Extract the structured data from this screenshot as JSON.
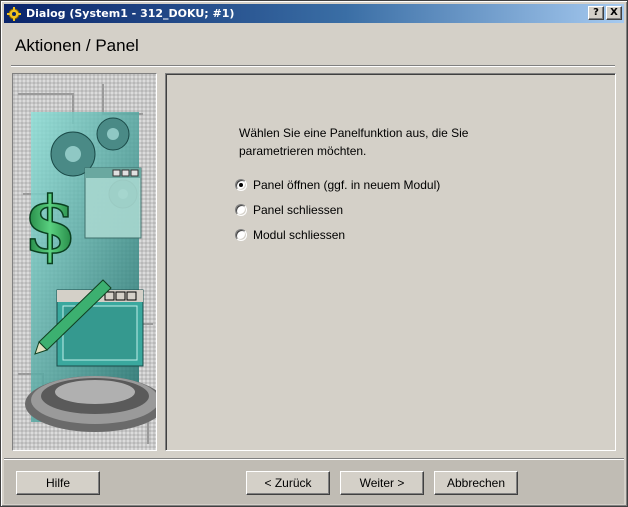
{
  "window": {
    "title": "Dialog (System1 - 312_DOKU; #1)",
    "help_button": "?",
    "close_button": "X"
  },
  "header": {
    "title": "Aktionen / Panel"
  },
  "content": {
    "prompt": "Wählen Sie eine Panelfunktion aus, die Sie parametrieren möchten.",
    "options": [
      {
        "label": "Panel öffnen (ggf. in neuem Modul)",
        "selected": true
      },
      {
        "label": "Panel schliessen",
        "selected": false
      },
      {
        "label": "Modul schliessen",
        "selected": false
      }
    ]
  },
  "buttons": {
    "help": "Hilfe",
    "back": "< Zurück",
    "next": "Weiter >",
    "cancel": "Abbrechen"
  },
  "colors": {
    "titlebar_start": "#0a246a",
    "titlebar_end": "#a6caf0",
    "dialog_bg": "#d4d0c8",
    "teal_accent": "#2e9a92"
  },
  "icons": {
    "title": "gear-icon",
    "illustration": "dollar-gears-window-illustration"
  }
}
